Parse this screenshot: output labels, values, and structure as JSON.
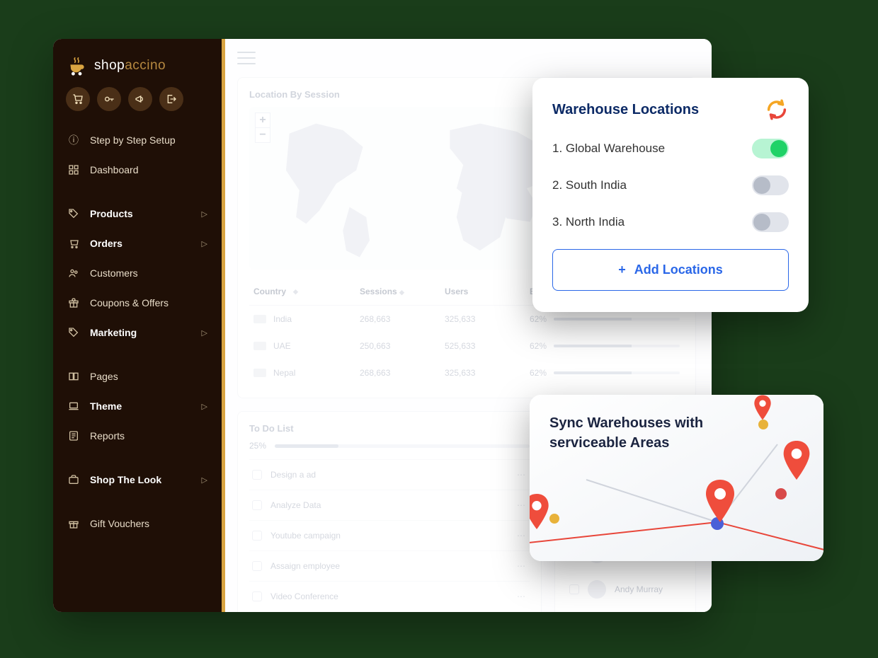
{
  "brand": {
    "name": "shop",
    "suffix": "accino"
  },
  "quick": {
    "cart": "cart",
    "key": "key",
    "horn": "announce",
    "exit": "exit"
  },
  "nav": {
    "setup": "Step by Step Setup",
    "dashboard": "Dashboard",
    "products": "Products",
    "orders": "Orders",
    "customers": "Customers",
    "coupons": "Coupons & Offers",
    "marketing": "Marketing",
    "pages": "Pages",
    "theme": "Theme",
    "reports": "Reports",
    "shopthelook": "Shop The Look",
    "giftvouchers": "Gift Vouchers"
  },
  "location_card": {
    "title": "Location By Session",
    "headers": {
      "country": "Country",
      "sessions": "Sessions",
      "users": "Users",
      "bounce": "Bounce Rate"
    },
    "rows": [
      {
        "country": "India",
        "sessions": "268,663",
        "users": "325,633",
        "bounce": "62%"
      },
      {
        "country": "UAE",
        "sessions": "250,663",
        "users": "525,633",
        "bounce": "62%"
      },
      {
        "country": "Nepal",
        "sessions": "268,663",
        "users": "325,633",
        "bounce": "62%"
      }
    ]
  },
  "todo": {
    "title": "To Do List",
    "progress": "25%",
    "items": [
      "Design a ad",
      "Analyze Data",
      "Youtube campaign",
      "Assaign employee",
      "Video Conference"
    ]
  },
  "contacts": {
    "items": [
      "",
      "Andy Murray"
    ]
  },
  "warehouse": {
    "title": "Warehouse Locations",
    "items": [
      {
        "label": "1. Global Warehouse",
        "on": true
      },
      {
        "label": "2. South India",
        "on": false
      },
      {
        "label": "3. North India",
        "on": false
      }
    ],
    "add": "Add Locations"
  },
  "sync": {
    "title": "Sync Warehouses with serviceable Areas"
  }
}
